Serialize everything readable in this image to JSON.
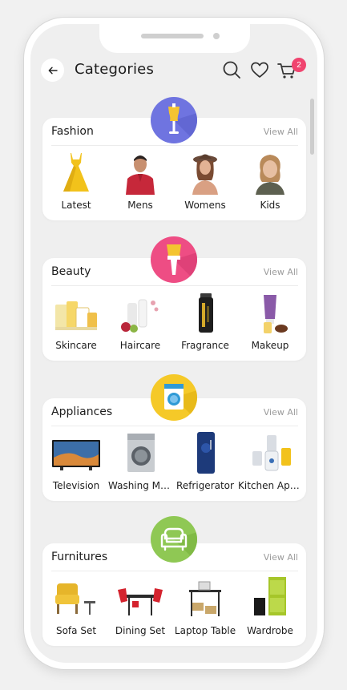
{
  "header": {
    "title": "Categories",
    "back_icon": "arrow-left-icon",
    "search_icon": "search-icon",
    "wishlist_icon": "heart-icon",
    "cart_icon": "cart-icon",
    "cart_count": "2"
  },
  "colors": {
    "fashion_badge": "#6f74e0",
    "beauty_badge": "#ee4d84",
    "appliances_badge": "#f5c928",
    "furnitures_badge": "#8fc854",
    "cart_badge": "#f0446f"
  },
  "categories": [
    {
      "title": "Fashion",
      "view_all": "View All",
      "icon": "dress-form-icon",
      "items": [
        {
          "label": "Latest",
          "icon": "yellow-dress"
        },
        {
          "label": "Mens",
          "icon": "man-red-shirt"
        },
        {
          "label": "Womens",
          "icon": "woman-hat"
        },
        {
          "label": "Kids",
          "icon": "child"
        }
      ]
    },
    {
      "title": "Beauty",
      "view_all": "View All",
      "icon": "brush-icon",
      "items": [
        {
          "label": "Skincare",
          "icon": "skincare-products"
        },
        {
          "label": "Haircare",
          "icon": "haircare-products"
        },
        {
          "label": "Fragrance",
          "icon": "fragrance-bottle"
        },
        {
          "label": "Makeup",
          "icon": "makeup-tube"
        }
      ]
    },
    {
      "title": "Appliances",
      "view_all": "View All",
      "icon": "washing-machine-icon",
      "items": [
        {
          "label": "Television",
          "icon": "tv"
        },
        {
          "label": "Washing Machine",
          "icon": "washing-machine"
        },
        {
          "label": "Refrigerator",
          "icon": "refrigerator"
        },
        {
          "label": "Kitchen Appliances",
          "icon": "mixer-grinder"
        }
      ]
    },
    {
      "title": "Furnitures",
      "view_all": "View All",
      "icon": "armchair-icon",
      "items": [
        {
          "label": "Sofa Set",
          "icon": "sofa-chair"
        },
        {
          "label": "Dining Set",
          "icon": "dining-set"
        },
        {
          "label": "Laptop Table",
          "icon": "laptop-table"
        },
        {
          "label": "Wardrobe",
          "icon": "wardrobe"
        }
      ]
    }
  ]
}
